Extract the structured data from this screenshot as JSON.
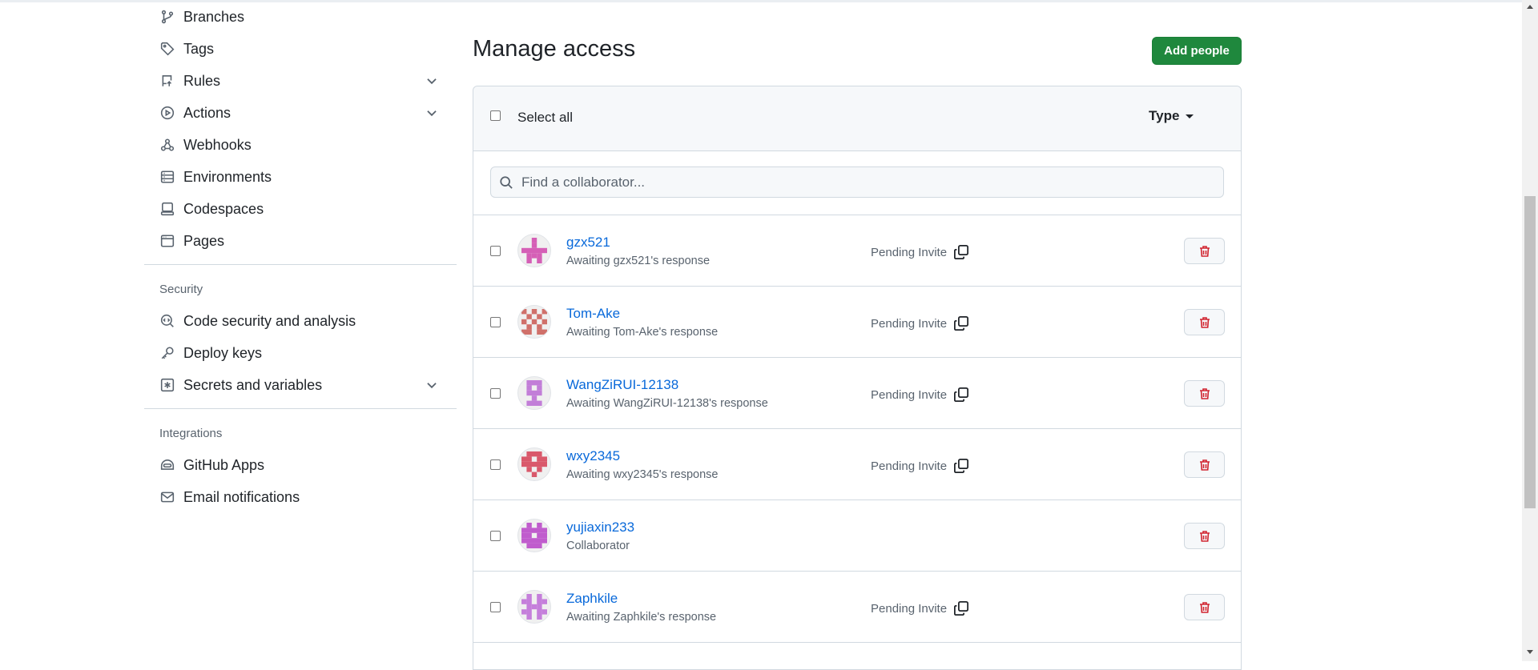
{
  "sidebar": {
    "items_top": [
      {
        "label": "Branches",
        "icon": "git-branch-icon"
      },
      {
        "label": "Tags",
        "icon": "tag-icon"
      },
      {
        "label": "Rules",
        "icon": "repo-push-icon",
        "expandable": true
      },
      {
        "label": "Actions",
        "icon": "play-icon",
        "expandable": true
      },
      {
        "label": "Webhooks",
        "icon": "webhook-icon"
      },
      {
        "label": "Environments",
        "icon": "server-icon"
      },
      {
        "label": "Codespaces",
        "icon": "codespaces-icon"
      },
      {
        "label": "Pages",
        "icon": "browser-icon"
      }
    ],
    "security_heading": "Security",
    "security_items": [
      {
        "label": "Code security and analysis",
        "icon": "codescan-icon"
      },
      {
        "label": "Deploy keys",
        "icon": "key-icon"
      },
      {
        "label": "Secrets and variables",
        "icon": "key-asterisk-icon",
        "expandable": true
      }
    ],
    "integrations_heading": "Integrations",
    "integrations_items": [
      {
        "label": "GitHub Apps",
        "icon": "hubot-icon"
      },
      {
        "label": "Email notifications",
        "icon": "mail-icon"
      }
    ]
  },
  "main": {
    "title": "Manage access",
    "add_button": "Add people",
    "select_all": "Select all",
    "type_filter": "Type",
    "search_placeholder": "Find a collaborator..."
  },
  "collaborators": [
    {
      "name": "gzx521",
      "status": "Awaiting gzx521's response",
      "pending": "Pending Invite",
      "avatar_color": "#d55fb6"
    },
    {
      "name": "Tom-Ake",
      "status": "Awaiting Tom-Ake's response",
      "pending": "Pending Invite",
      "avatar_color": "#d0706a"
    },
    {
      "name": "WangZiRUI-12138",
      "status": "Awaiting WangZiRUI-12138's response",
      "pending": "Pending Invite",
      "avatar_color": "#c27ed8"
    },
    {
      "name": "wxy2345",
      "status": "Awaiting wxy2345's response",
      "pending": "Pending Invite",
      "avatar_color": "#d9596b"
    },
    {
      "name": "yujiaxin233",
      "status": "Collaborator",
      "pending": "",
      "avatar_color": "#c05ccd"
    },
    {
      "name": "Zaphkile",
      "status": "Awaiting Zaphkile's response",
      "pending": "Pending Invite",
      "avatar_color": "#c57fdb"
    }
  ],
  "colors": {
    "accent_link": "#0969da",
    "primary_button": "#1f883d",
    "danger": "#d1242f"
  }
}
